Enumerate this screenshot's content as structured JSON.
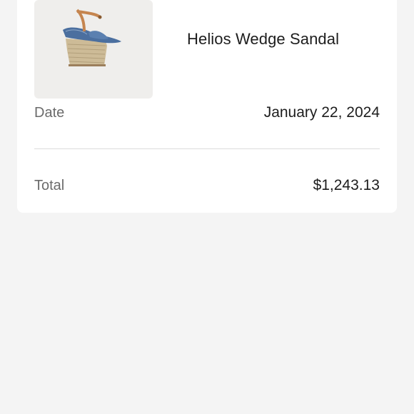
{
  "order": {
    "product": {
      "name": "Helios Wedge Sandal",
      "image_icon": "wedge-sandal-image"
    },
    "date": {
      "label": "Date",
      "value": "January 22, 2024"
    },
    "total": {
      "label": "Total",
      "value": "$1,243.13"
    }
  },
  "colors": {
    "background": "#f4f4f4",
    "card": "#ffffff",
    "text_primary": "#1d1d1d",
    "text_secondary": "#6b6b6b",
    "divider": "#dcdcdc"
  }
}
